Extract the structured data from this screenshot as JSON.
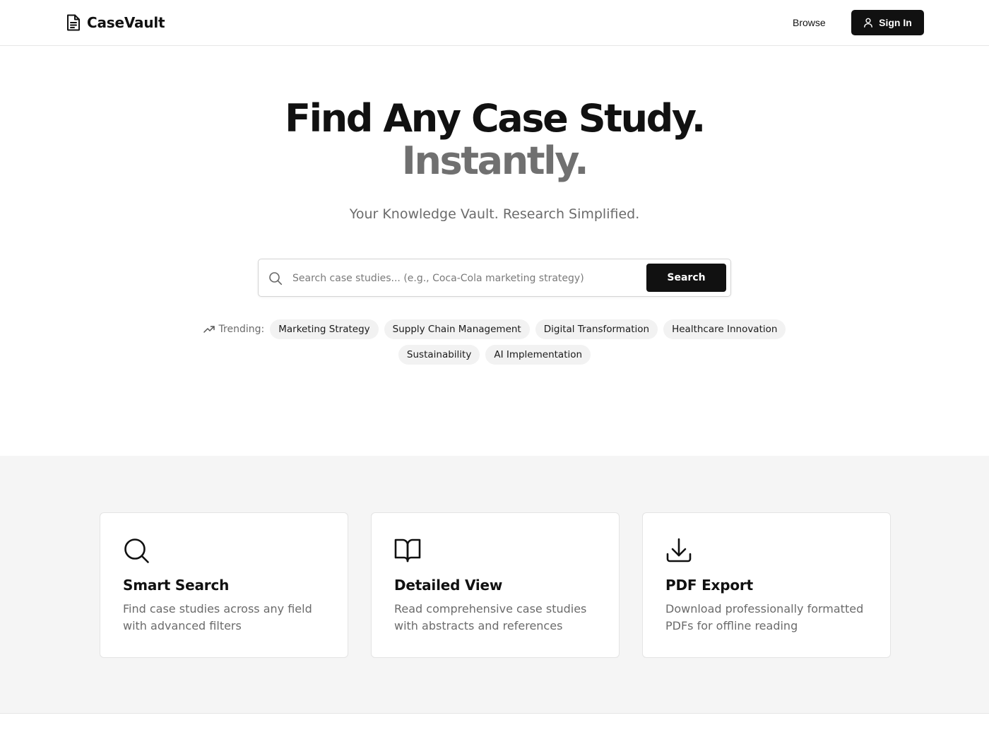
{
  "header": {
    "brand": "CaseVault",
    "brand_icon": "document-icon",
    "nav_browse": "Browse",
    "signin_label": "Sign In",
    "signin_icon": "user-icon"
  },
  "hero": {
    "title_line1": "Find Any Case Study.",
    "title_line2": "Instantly.",
    "subtitle": "Your Knowledge Vault. Research Simplified."
  },
  "search": {
    "placeholder": "Search case studies... (e.g., Coca-Cola marketing strategy)",
    "value": "",
    "button_label": "Search",
    "icon": "search-icon"
  },
  "trending": {
    "label": "Trending:",
    "icon": "trending-up-icon",
    "items": [
      "Marketing Strategy",
      "Supply Chain Management",
      "Digital Transformation",
      "Healthcare Innovation",
      "Sustainability",
      "AI Implementation"
    ]
  },
  "features": [
    {
      "icon": "search-icon",
      "title": "Smart Search",
      "description": "Find case studies across any field with advanced filters"
    },
    {
      "icon": "book-open-icon",
      "title": "Detailed View",
      "description": "Read comprehensive case studies with abstracts and references"
    },
    {
      "icon": "download-icon",
      "title": "PDF Export",
      "description": "Download professionally formatted PDFs for offline reading"
    }
  ],
  "colors": {
    "primary": "#111111",
    "muted_text": "#6b6b6b",
    "hero_accent": "#707070",
    "chip_bg": "#f2f2f2",
    "section_bg": "#f5f5f5"
  }
}
